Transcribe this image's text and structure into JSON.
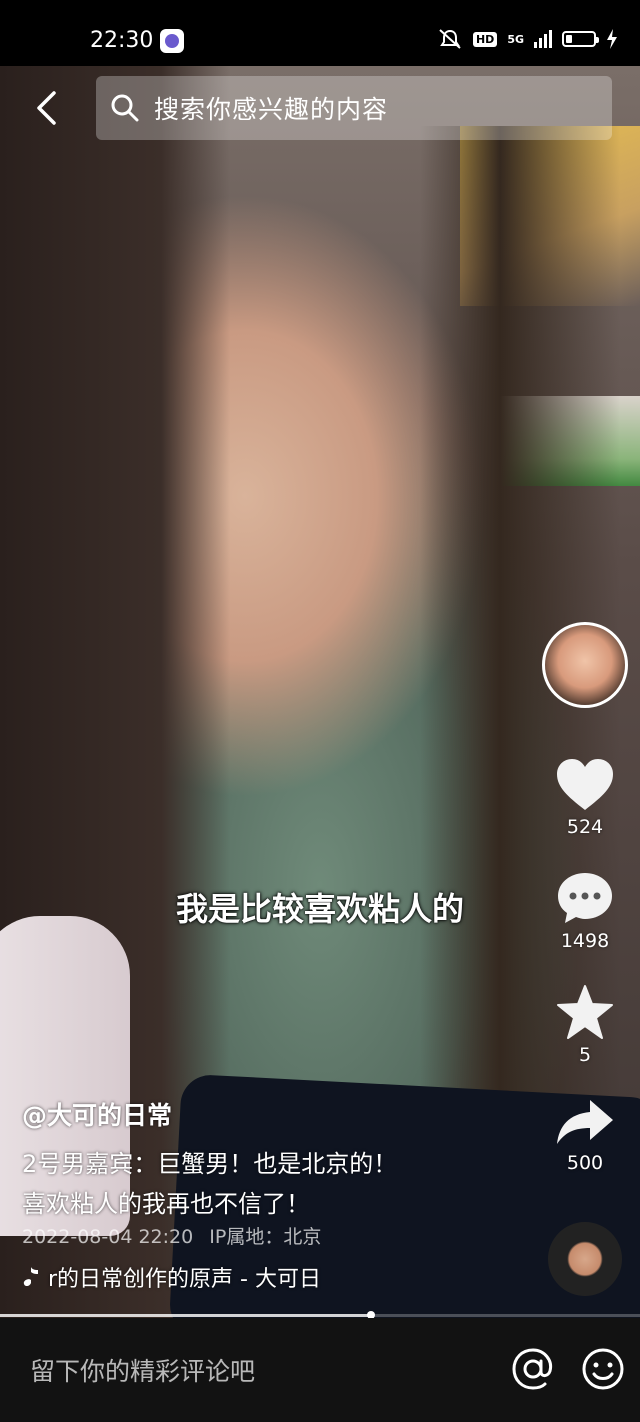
{
  "status_bar": {
    "time": "22:30",
    "network": "5G",
    "hd_label": "HD",
    "icons": [
      "app-notification-icon",
      "mute-icon",
      "signal-icon",
      "battery-icon",
      "charging-icon"
    ]
  },
  "search": {
    "placeholder": "搜索你感兴趣的内容",
    "back_icon": "back-arrow-icon",
    "search_icon": "search-icon"
  },
  "video": {
    "subtitle": "我是比较喜欢粘人的",
    "progress_fraction": 0.58
  },
  "sidebar": {
    "like_count": "524",
    "comment_count": "1498",
    "favorite_count": "5",
    "share_count": "500"
  },
  "post": {
    "author": "@大可的日常",
    "description_line1": "2号男嘉宾：巨蟹男！也是北京的！",
    "description_line2": "喜欢粘人的我再也不信了！",
    "date": "2022-08-04 22:20",
    "ip_location": "IP属地：北京",
    "music": "r的日常创作的原声 - 大可日"
  },
  "comment_bar": {
    "placeholder": "留下你的精彩评论吧",
    "at_icon": "at-icon",
    "emoji_icon": "emoji-icon"
  },
  "colors": {
    "background": "#000000",
    "comment_bar": "#121212",
    "text": "#ffffff"
  }
}
